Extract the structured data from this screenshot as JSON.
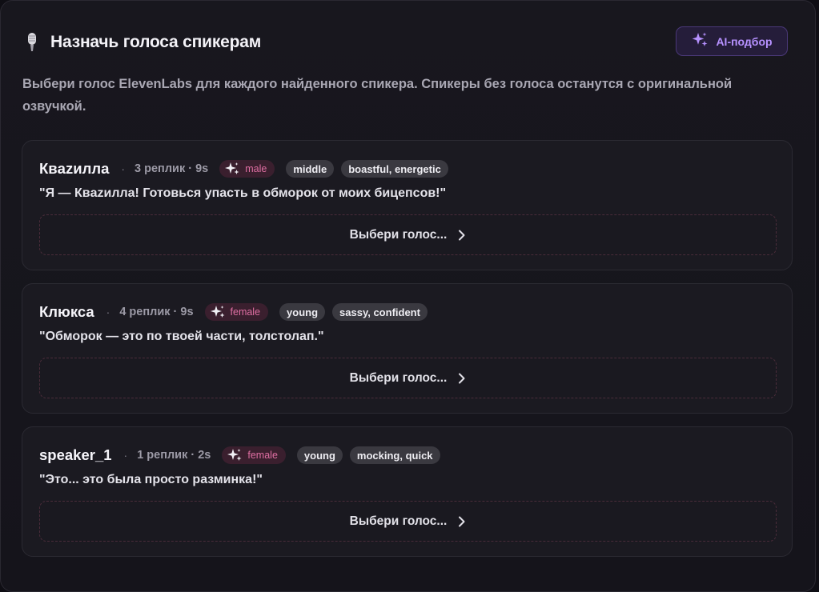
{
  "header": {
    "title": "Назначь голоса спикерам",
    "ai_button": "AI-подбор"
  },
  "subtitle": "Выбери голос ElevenLabs для каждого найденного спикера. Спикеры без голоса останутся с оригинальной озвучкой.",
  "speakers": [
    {
      "name": "Квazилла",
      "meta": "3 реплик · 9s",
      "gender": "male",
      "age": "middle",
      "traits": "boastful, energetic",
      "quote": "\"Я — Квazилла! Готовься упасть в обморок от моих бицепсов!\"",
      "pick_label": "Выбери голос..."
    },
    {
      "name": "Клюкса",
      "meta": "4 реплик · 9s",
      "gender": "female",
      "age": "young",
      "traits": "sassy, confident",
      "quote": "\"Обморок — это по твоей части, толстолап.\"",
      "pick_label": "Выбери голос..."
    },
    {
      "name": "speaker_1",
      "meta": "1 реплик · 2s",
      "gender": "female",
      "age": "young",
      "traits": "mocking, quick",
      "quote": "\"Это... это была просто разминка!\"",
      "pick_label": "Выбери голос..."
    }
  ],
  "separator": "·",
  "colors": {
    "accent_purple": "#b691ff",
    "gender_pink": "#e06fa3",
    "background": "#18171e"
  },
  "icons": {
    "title": "microphone-icon",
    "ai": "sparkles-icon",
    "gender": "sparkles-icon",
    "pick": "chevron-right-icon"
  }
}
